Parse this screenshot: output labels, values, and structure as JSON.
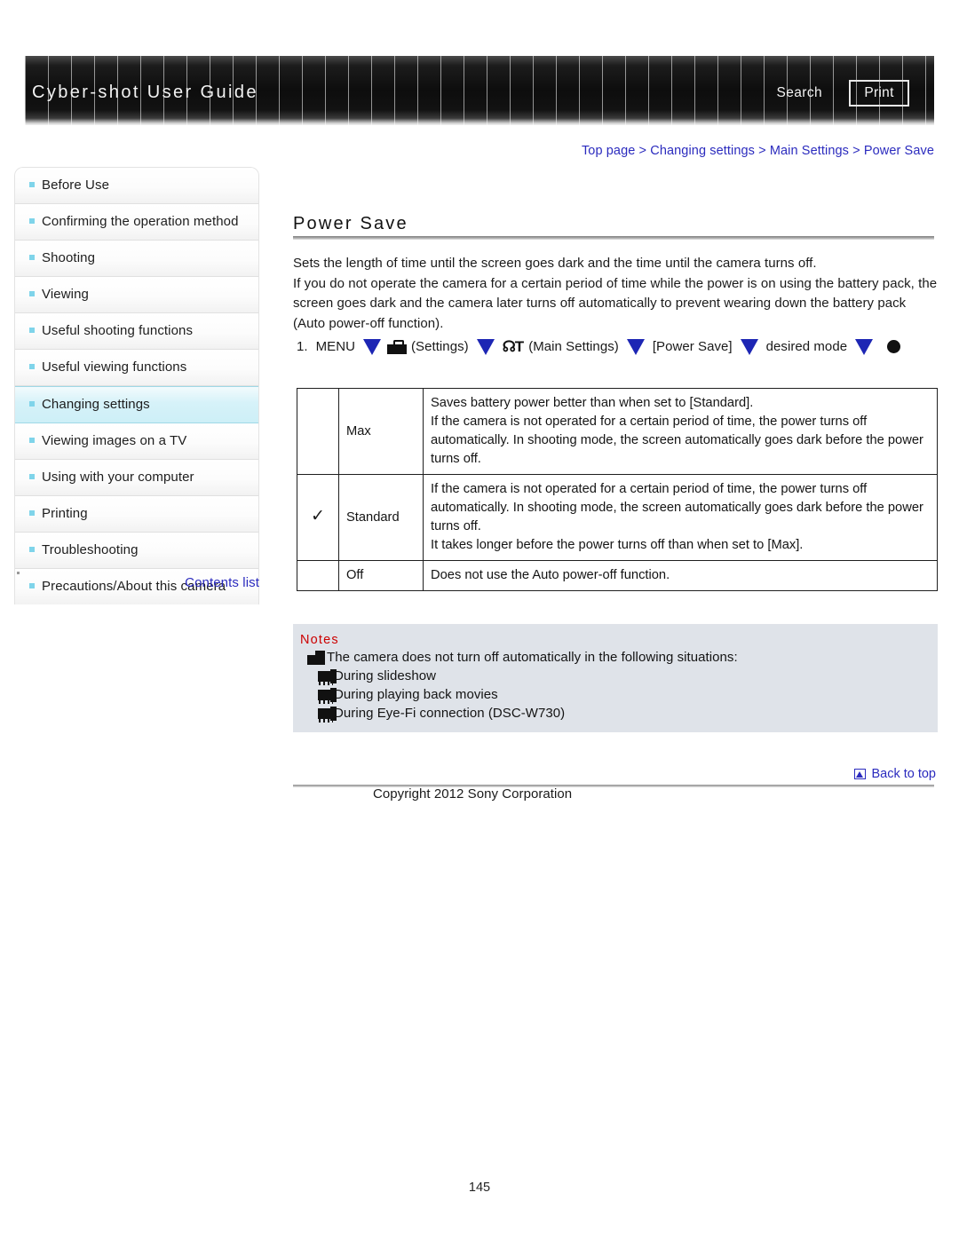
{
  "header": {
    "title": "Cyber-shot User Guide",
    "search_label": "Search",
    "print_label": "Print"
  },
  "breadcrumb": {
    "text": "Top page > Changing settings > Main Settings > Power Save"
  },
  "sidebar": {
    "items": [
      {
        "label": "Before Use",
        "active": false
      },
      {
        "label": "Confirming the operation method",
        "active": false
      },
      {
        "label": "Shooting",
        "active": false
      },
      {
        "label": "Viewing",
        "active": false
      },
      {
        "label": "Useful shooting functions",
        "active": false
      },
      {
        "label": "Useful viewing functions",
        "active": false
      },
      {
        "label": "Changing settings",
        "active": true
      },
      {
        "label": "Viewing images on a TV",
        "active": false
      },
      {
        "label": "Using with your computer",
        "active": false
      },
      {
        "label": "Printing",
        "active": false
      },
      {
        "label": "Troubleshooting",
        "active": false
      },
      {
        "label": "Precautions/About this camera",
        "active": false
      }
    ],
    "contents_list_label": "Contents list"
  },
  "main": {
    "page_title": "Power Save",
    "intro_lines": [
      "Sets the length of time until the screen goes dark and the time until the camera turns off.",
      "If you do not operate the camera for a certain period of time while the power is on using the battery pack, the screen goes dark and the camera later turns off automatically to prevent wearing down the battery pack (Auto power-off function)."
    ],
    "step": {
      "number": "1.",
      "menu_label": "MENU",
      "settings_label": "(Settings)",
      "main_settings_label": "(Main Settings)",
      "power_save_label": "[Power Save]",
      "desired_mode_label": "desired mode"
    },
    "table": {
      "rows": [
        {
          "checked": false,
          "check_glyph": "",
          "name": "Max",
          "description": [
            "Saves battery power better than when set to [Standard].",
            "If the camera is not operated for a certain period of time, the power turns off automatically. In shooting mode, the screen automatically goes dark before the power turns off."
          ]
        },
        {
          "checked": true,
          "check_glyph": "✓",
          "name": "Standard",
          "description": [
            "If the camera is not operated for a certain period of time, the power turns off automatically. In shooting mode, the screen automatically goes dark before the power turns off.",
            "It takes longer before the power turns off than when set to [Max]."
          ]
        },
        {
          "checked": false,
          "check_glyph": "",
          "name": "Off",
          "description": [
            "Does not use the Auto power-off function."
          ]
        }
      ]
    },
    "notes": {
      "label": "Notes",
      "lead": "The camera does not turn off automatically in the following situations:",
      "items": [
        "During slideshow",
        "During playing back movies",
        "During Eye-Fi connection (DSC-W730)"
      ]
    }
  },
  "footer": {
    "back_to_top_label": "Back to top",
    "copyright": "Copyright 2012 Sony Corporation",
    "page_number": "145"
  },
  "colors": {
    "link": "#2b2bbe",
    "notes_label": "#cc0000",
    "accent_bullet": "#7fd4ea",
    "arrow": "#1d26b4",
    "active_nav": "#cdeff7"
  }
}
